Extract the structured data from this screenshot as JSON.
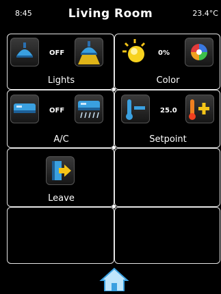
{
  "header": {
    "time": "8:45",
    "title": "Living Room",
    "temperature": "23.4°C"
  },
  "tiles": {
    "lights": {
      "label": "Lights",
      "value": "OFF"
    },
    "color": {
      "label": "Color",
      "value": "0%"
    },
    "ac": {
      "label": "A/C",
      "value": "OFF"
    },
    "setpoint": {
      "label": "Setpoint",
      "value": "25.0"
    },
    "leave": {
      "label": "Leave"
    }
  },
  "icons": [
    "lamp-off-icon",
    "lamp-on-icon",
    "sun-icon",
    "color-wheel-icon",
    "ac-off-icon",
    "ac-on-icon",
    "thermometer-minus-icon",
    "thermometer-plus-icon",
    "leave-door-icon",
    "home-icon"
  ],
  "colors": {
    "background": "#000000",
    "accent": "#3aa0e0",
    "lamp_on": "#f5c518",
    "border": "#e6e6e6"
  }
}
